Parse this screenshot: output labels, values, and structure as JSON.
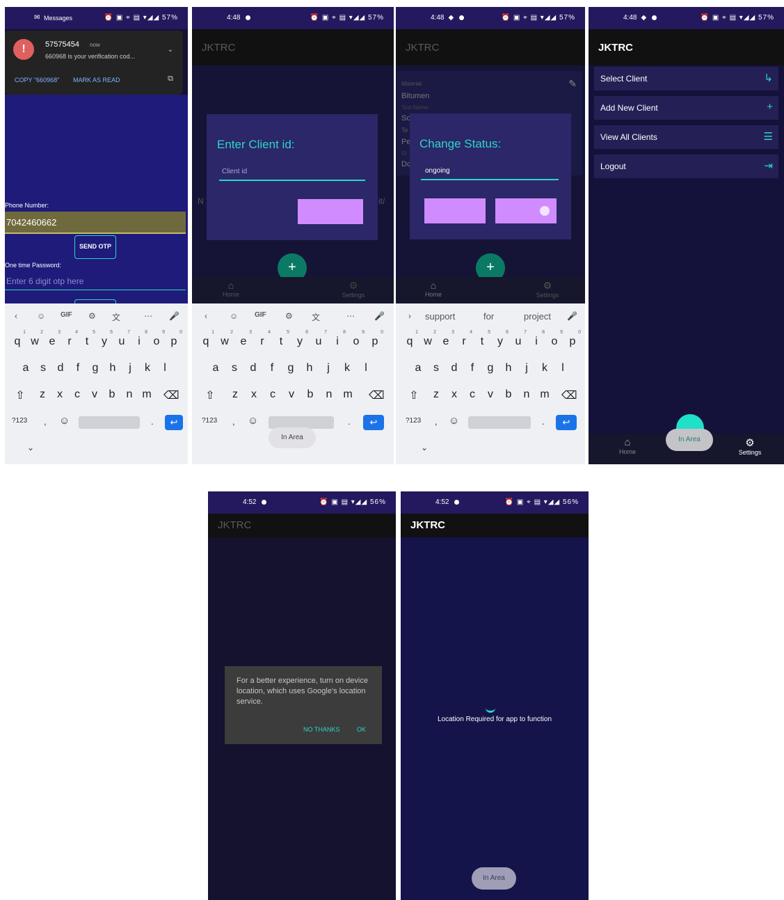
{
  "status_bars": {
    "p1_label": "Messages",
    "p1_battery": "57%",
    "p2_time": "4:48",
    "p2_battery": "57%",
    "p3_time": "4:48",
    "p3_battery": "57%",
    "p4_time": "4:48",
    "p4_battery": "57%",
    "p5_time": "4:52",
    "p5_battery": "56%",
    "p6_time": "4:52",
    "p6_battery": "56%"
  },
  "app_title": "JKTRC",
  "notification": {
    "sender": "57575454",
    "when": "now",
    "body": "660968 is your verification cod...",
    "copy_action": "COPY \"660968\"",
    "read_action": "MARK AS READ"
  },
  "login": {
    "phone_label": "Phone Number:",
    "phone_value": "7042460662",
    "send_otp": "SEND OTP",
    "otp_label": "One time Password:",
    "otp_placeholder": "Enter 6 digit otp here"
  },
  "keyboard": {
    "toolbar_gif": "GIF",
    "row1": [
      "q",
      "w",
      "e",
      "r",
      "t",
      "y",
      "u",
      "i",
      "o",
      "p"
    ],
    "row1_nums": [
      "1",
      "2",
      "3",
      "4",
      "5",
      "6",
      "7",
      "8",
      "9",
      "0"
    ],
    "row2": [
      "a",
      "s",
      "d",
      "f",
      "g",
      "h",
      "j",
      "k",
      "l"
    ],
    "row3": [
      "z",
      "x",
      "c",
      "v",
      "b",
      "n",
      "m"
    ],
    "symbols": "?123",
    "comma": ",",
    "period": ".",
    "suggestions": [
      "support",
      "for",
      "project"
    ]
  },
  "client_dialog": {
    "title": "Enter Client id:",
    "placeholder": "Client id",
    "bg_left": "N",
    "bg_right": "it/"
  },
  "status_dialog": {
    "title": "Change Status:",
    "value": "ongoing",
    "bg_material_label": "Material:",
    "bg_material_value": "Bitumen",
    "bg_test_label": "Test Name:",
    "bg_so": "So",
    "bg_te": "Te",
    "bg_pe": "Pe",
    "bg_st": "St",
    "bg_dc": "Dc"
  },
  "nav": {
    "home": "Home",
    "settings": "Settings"
  },
  "menu": {
    "items": [
      {
        "label": "Select Client",
        "icon": "arrow-turn-icon"
      },
      {
        "label": "Add New Client",
        "icon": "plus-icon"
      },
      {
        "label": "View All Clients",
        "icon": "list-icon"
      },
      {
        "label": "Logout",
        "icon": "logout-icon"
      }
    ]
  },
  "in_area": "In Area",
  "location_dialog": {
    "text": "For a better experience, turn on device location, which uses Google's location service.",
    "no_thanks": "NO THANKS",
    "ok": "OK"
  },
  "location_required": "Location Required for app to function",
  "colors": {
    "accent": "#2cd6c7",
    "button": "#d08cff",
    "status_bar": "#24185e",
    "background": "#141233"
  }
}
